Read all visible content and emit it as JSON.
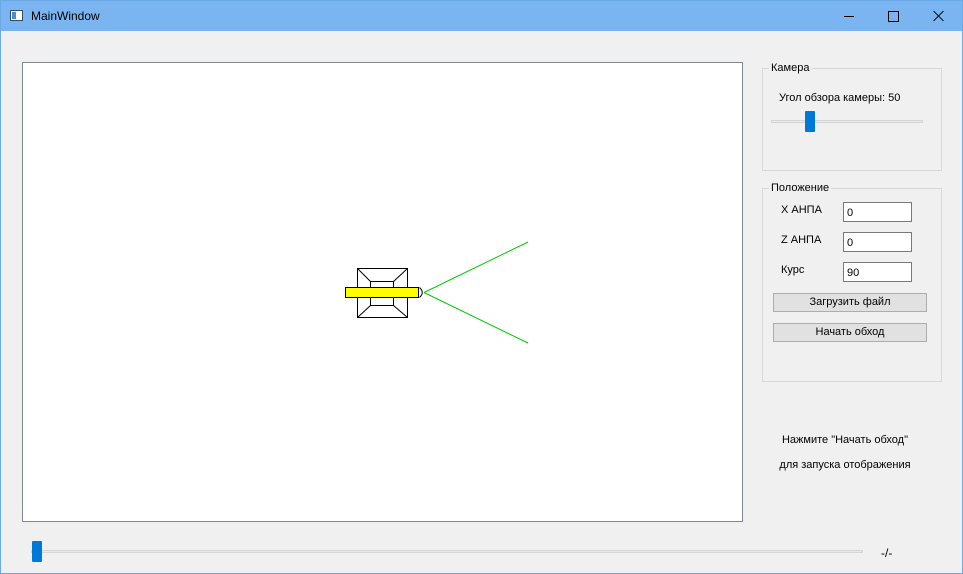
{
  "window": {
    "title": "MainWindow"
  },
  "camera": {
    "group_title": "Камера",
    "view_angle_label": "Угол обзора камеры: 50",
    "view_angle": 50
  },
  "position": {
    "group_title": "Положение",
    "x_label": "X АНПА",
    "x_value": "0",
    "z_label": "Z АНПА",
    "z_value": "0",
    "heading_label": "Курс",
    "heading_value": "90",
    "load_button": "Загрузить файл",
    "start_button": "Начать обход"
  },
  "hint": {
    "line1": "Нажмите \"Начать обход\"",
    "line2": "для запуска отображения"
  },
  "timeline": {
    "label": "-/-",
    "position": 0
  },
  "colors": {
    "accent": "#0078d7",
    "vehicle_bar": "#ffff00",
    "fov_lines": "#00cc00"
  }
}
